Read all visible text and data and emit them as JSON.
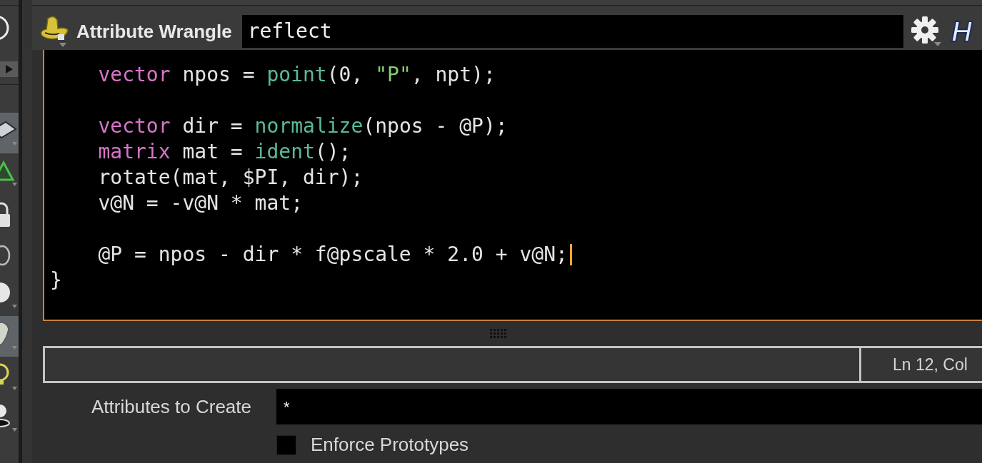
{
  "toolbar": {
    "tools": [
      {
        "selected": true
      },
      {
        "selected": false
      },
      {
        "selected": false
      },
      {
        "selected": false
      },
      {
        "selected": false
      },
      {
        "selected": true
      },
      {
        "selected": false
      },
      {
        "selected": false
      }
    ]
  },
  "node_header": {
    "type_label": "Attribute Wrangle",
    "name_field": {
      "value": "reflect"
    },
    "help_button": {
      "label": "H"
    }
  },
  "code_editor": {
    "lines": [
      {
        "kind": "block",
        "cursor": false,
        "tokens": [
          {
            "kind": "keyword",
            "text": "vector"
          },
          {
            "kind": "plain",
            "text": " npos = "
          },
          {
            "kind": "function",
            "text": "point"
          },
          {
            "kind": "plain",
            "text": "(0, "
          },
          {
            "kind": "string",
            "text": "\"P\""
          },
          {
            "kind": "plain",
            "text": ", npt);"
          }
        ]
      },
      {
        "kind": "blank",
        "cursor": false
      },
      {
        "kind": "block",
        "cursor": false,
        "tokens": [
          {
            "kind": "keyword",
            "text": "vector"
          },
          {
            "kind": "plain",
            "text": " dir = "
          },
          {
            "kind": "function",
            "text": "normalize"
          },
          {
            "kind": "plain",
            "text": "(npos - @P);"
          }
        ]
      },
      {
        "kind": "block",
        "cursor": false,
        "tokens": [
          {
            "kind": "keyword",
            "text": "matrix"
          },
          {
            "kind": "plain",
            "text": " mat = "
          },
          {
            "kind": "function",
            "text": "ident"
          },
          {
            "kind": "plain",
            "text": "();"
          }
        ]
      },
      {
        "kind": "block",
        "cursor": false,
        "tokens": [
          {
            "kind": "plain",
            "text": "rotate(mat, $PI, dir);"
          }
        ]
      },
      {
        "kind": "block",
        "cursor": false,
        "tokens": [
          {
            "kind": "plain",
            "text": "v@N = -v@N * mat;"
          }
        ]
      },
      {
        "kind": "blank",
        "cursor": false
      },
      {
        "kind": "block",
        "cursor": true,
        "tokens": [
          {
            "kind": "plain",
            "text": "@P = npos - dir * f@pscale * 2.0 + v@N;"
          }
        ]
      },
      {
        "kind": "top",
        "cursor": false,
        "tokens": [
          {
            "kind": "plain",
            "text": "}"
          }
        ]
      }
    ]
  },
  "status_bar": {
    "position": "Ln 12, Col"
  },
  "parameters": [
    {
      "kind": "text",
      "label": "Attributes to Create",
      "value": "*"
    },
    {
      "kind": "checkbox",
      "label": "Enforce Prototypes",
      "checked": false
    }
  ]
}
